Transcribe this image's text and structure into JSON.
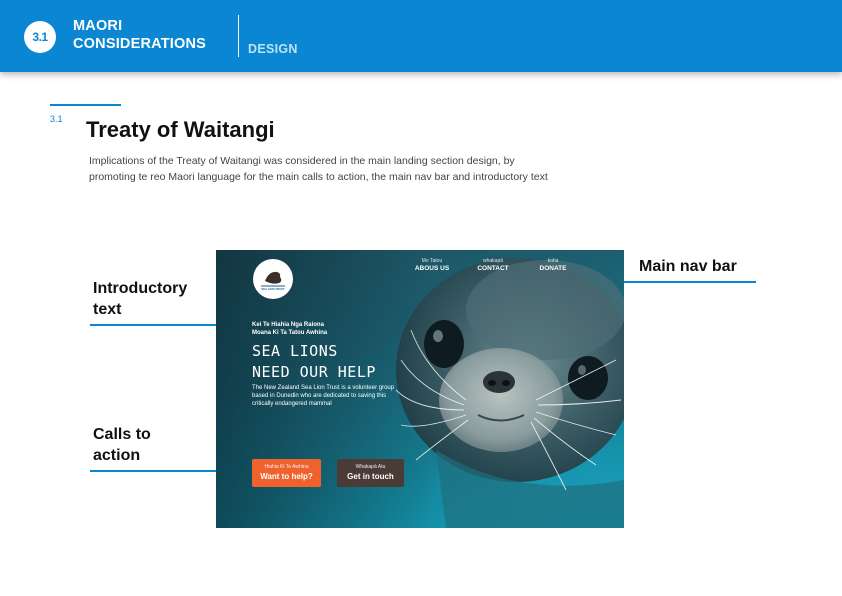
{
  "header": {
    "badge": "3.1",
    "title_line1": "MAORI",
    "title_line2": "CONSIDERATIONS",
    "section": "DESIGN"
  },
  "section": {
    "number": "3.1",
    "title": "Treaty of Waitangi",
    "description": "Implications of the Treaty of Waitangi was considered in the main landing section design, by promoting te reo Maori language for the main calls to action, the main nav bar and introductory text"
  },
  "annotations": {
    "intro_line1": "Introductory",
    "intro_line2": "text",
    "cta_line1": "Calls to",
    "cta_line2": "action",
    "nav": "Main nav bar"
  },
  "mockup": {
    "logo_text": "SEA LION TRUST",
    "nav": [
      {
        "sub": "Mo Tatou",
        "label": "ABOUS US"
      },
      {
        "sub": "whakapā",
        "label": "CONTACT"
      },
      {
        "sub": "koha",
        "label": "DONATE"
      }
    ],
    "intro_line1": "Kei Te Hiahia Nga Raiona",
    "intro_line2": "Moana Ki Ta Tatou Awhina",
    "hero_line1": "SEA LIONS",
    "hero_line2": "NEED OUR HELP",
    "body": "The New Zealand Sea Lion Trust is a volunteer group based in Dunedin who are dedicated to saving this critically endangered mammal",
    "cta_help": {
      "sub": "Hiahia Ki Te Awhina",
      "label": "Want to help?",
      "color": "#f0622d"
    },
    "cta_touch": {
      "sub": "Whakapā Atu",
      "label": "Get in touch",
      "color": "#4a3b37"
    }
  },
  "colors": {
    "accent": "#0a86d2"
  }
}
